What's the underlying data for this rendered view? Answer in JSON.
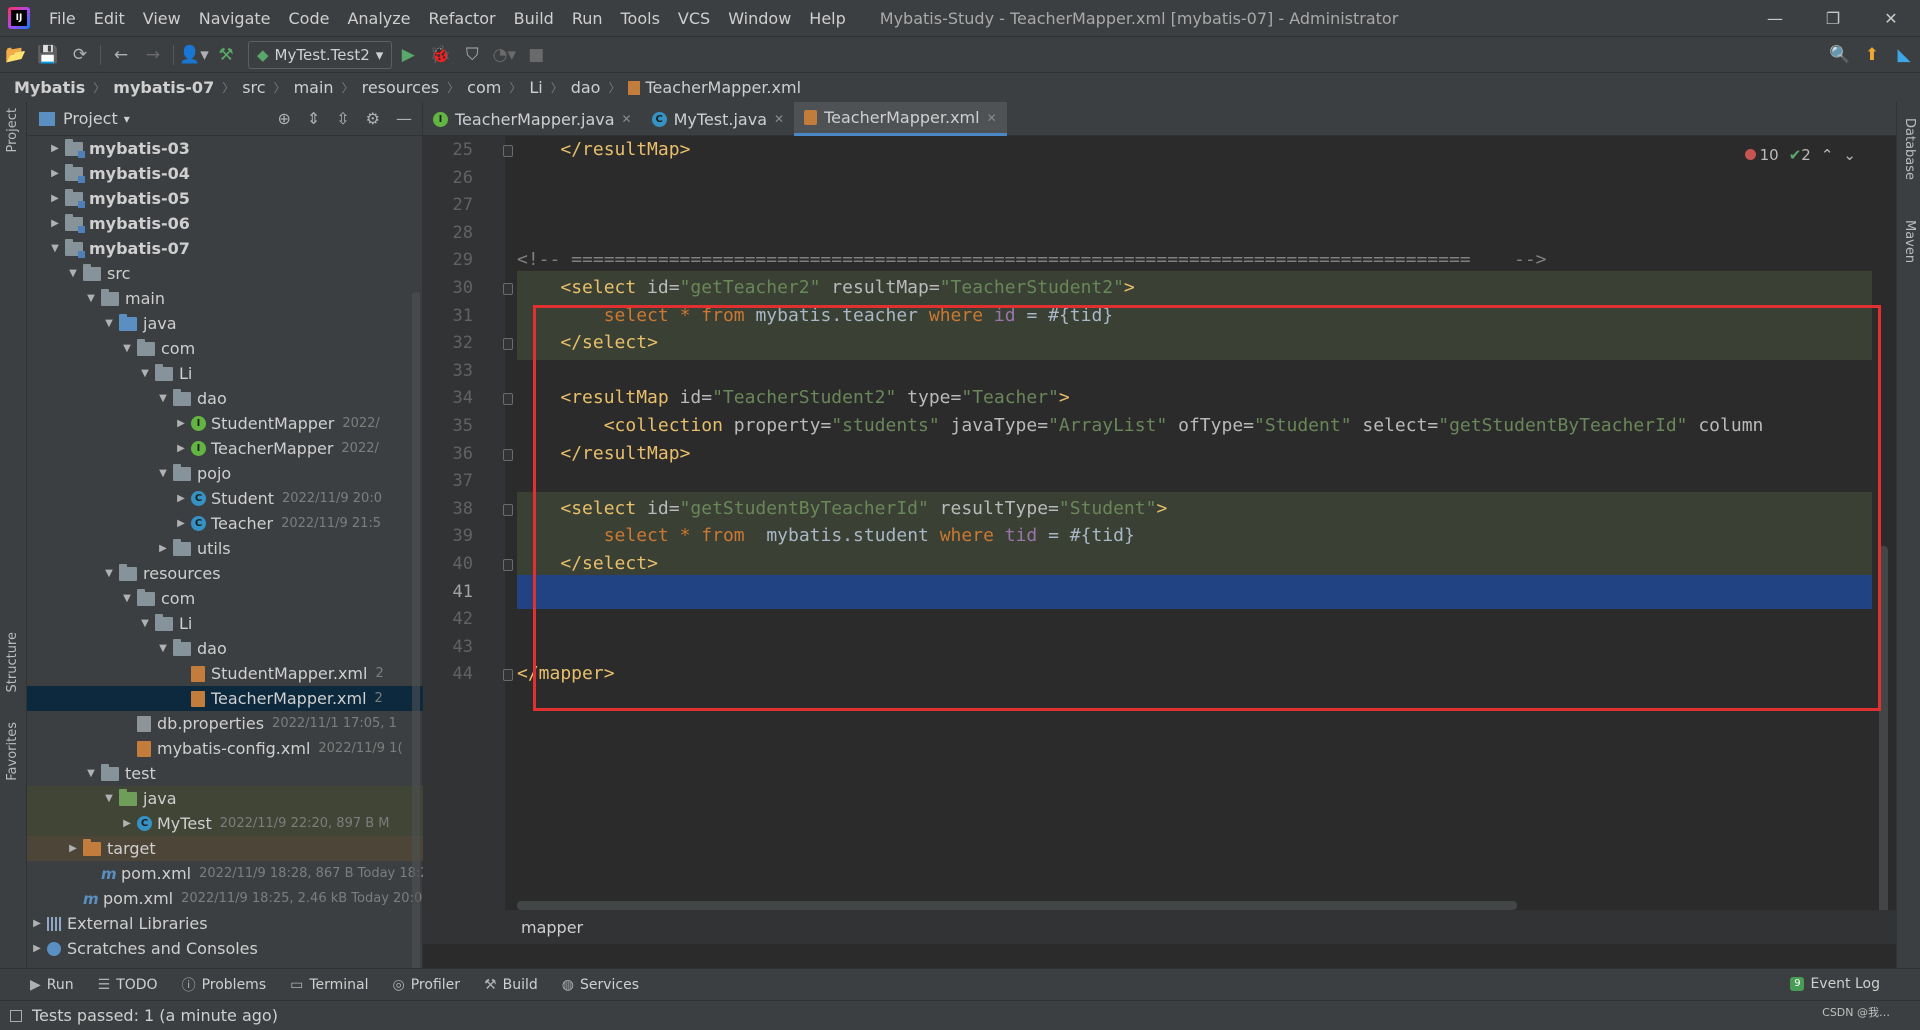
{
  "window": {
    "menu": [
      "File",
      "Edit",
      "View",
      "Navigate",
      "Code",
      "Analyze",
      "Refactor",
      "Build",
      "Run",
      "Tools",
      "VCS",
      "Window",
      "Help"
    ],
    "title": "Mybatis-Study - TeacherMapper.xml [mybatis-07] - Administrator",
    "controls": {
      "minimize": "—",
      "restore": "❐",
      "close": "✕"
    }
  },
  "toolbar": {
    "run_config": "MyTest.Test2"
  },
  "breadcrumb": [
    "Mybatis",
    "mybatis-07",
    "src",
    "main",
    "resources",
    "com",
    "Li",
    "dao",
    "TeacherMapper.xml"
  ],
  "left_stripe": {
    "project": "Project",
    "structure": "Structure",
    "favorites": "Favorites"
  },
  "right_stripe": {
    "database": "Database",
    "maven": "Maven"
  },
  "project_panel": {
    "title": "Project",
    "tree": [
      {
        "label": "mybatis-03",
        "meta": "",
        "icon": "module",
        "arrow": "›",
        "indent": 0,
        "bold": true
      },
      {
        "label": "mybatis-04",
        "meta": "",
        "icon": "module",
        "arrow": "›",
        "indent": 0,
        "bold": true
      },
      {
        "label": "mybatis-05",
        "meta": "",
        "icon": "module",
        "arrow": "›",
        "indent": 0,
        "bold": true
      },
      {
        "label": "mybatis-06",
        "meta": "",
        "icon": "module",
        "arrow": "›",
        "indent": 0,
        "bold": true
      },
      {
        "label": "mybatis-07",
        "meta": "",
        "icon": "module",
        "arrow": "⌄",
        "indent": 0,
        "bold": true
      },
      {
        "label": "src",
        "meta": "",
        "icon": "folder",
        "arrow": "⌄",
        "indent": 1
      },
      {
        "label": "main",
        "meta": "",
        "icon": "folder",
        "arrow": "⌄",
        "indent": 2
      },
      {
        "label": "java",
        "meta": "",
        "icon": "folder-blue",
        "arrow": "⌄",
        "indent": 3
      },
      {
        "label": "com",
        "meta": "",
        "icon": "folder",
        "arrow": "⌄",
        "indent": 4
      },
      {
        "label": "Li",
        "meta": "",
        "icon": "folder",
        "arrow": "⌄",
        "indent": 5
      },
      {
        "label": "dao",
        "meta": "",
        "icon": "folder",
        "arrow": "⌄",
        "indent": 6
      },
      {
        "label": "StudentMapper",
        "meta": "2022/",
        "icon": "interface",
        "arrow": "›",
        "indent": 7
      },
      {
        "label": "TeacherMapper",
        "meta": "2022/",
        "icon": "interface",
        "arrow": "›",
        "indent": 7
      },
      {
        "label": "pojo",
        "meta": "",
        "icon": "folder",
        "arrow": "⌄",
        "indent": 6
      },
      {
        "label": "Student",
        "meta": "2022/11/9 20:0",
        "icon": "class",
        "arrow": "›",
        "indent": 7
      },
      {
        "label": "Teacher",
        "meta": "2022/11/9 21:5",
        "icon": "class",
        "arrow": "›",
        "indent": 7
      },
      {
        "label": "utils",
        "meta": "",
        "icon": "folder",
        "arrow": "›",
        "indent": 6
      },
      {
        "label": "resources",
        "meta": "",
        "icon": "folder-res",
        "arrow": "⌄",
        "indent": 3
      },
      {
        "label": "com",
        "meta": "",
        "icon": "folder",
        "arrow": "⌄",
        "indent": 4
      },
      {
        "label": "Li",
        "meta": "",
        "icon": "folder",
        "arrow": "⌄",
        "indent": 5
      },
      {
        "label": "dao",
        "meta": "",
        "icon": "folder",
        "arrow": "⌄",
        "indent": 6
      },
      {
        "label": "StudentMapper.xml",
        "meta": "2",
        "icon": "xml",
        "arrow": "",
        "indent": 7
      },
      {
        "label": "TeacherMapper.xml",
        "meta": "2",
        "icon": "xml",
        "arrow": "",
        "indent": 7,
        "selected": true
      },
      {
        "label": "db.properties",
        "meta": "2022/11/1 17:05, 1",
        "icon": "props",
        "arrow": "",
        "indent": 4
      },
      {
        "label": "mybatis-config.xml",
        "meta": "2022/11/9 1(",
        "icon": "xml",
        "arrow": "",
        "indent": 4
      },
      {
        "label": "test",
        "meta": "",
        "icon": "folder",
        "arrow": "⌄",
        "indent": 2
      },
      {
        "label": "java",
        "meta": "",
        "icon": "folder-green",
        "arrow": "⌄",
        "indent": 3,
        "testbg": true
      },
      {
        "label": "MyTest",
        "meta": "2022/11/9 22:20, 897 B M",
        "icon": "class",
        "arrow": "›",
        "indent": 4,
        "testbg": true
      },
      {
        "label": "target",
        "meta": "",
        "icon": "folder-orange",
        "arrow": "›",
        "indent": 1,
        "targetbg": true
      },
      {
        "label": "pom.xml",
        "meta": "2022/11/9 18:28, 867 B Today 18:2!",
        "icon": "maven",
        "arrow": "",
        "indent": 2
      },
      {
        "label": "pom.xml",
        "meta": "2022/11/9 18:25, 2.46 kB Today 20:06",
        "icon": "maven",
        "arrow": "",
        "indent": 1
      },
      {
        "label": "External Libraries",
        "meta": "",
        "icon": "lib",
        "arrow": "›",
        "indent": -1
      },
      {
        "label": "Scratches and Consoles",
        "meta": "",
        "icon": "scratch",
        "arrow": "›",
        "indent": -1
      }
    ]
  },
  "editor_tabs": [
    {
      "label": "TeacherMapper.java",
      "icon": "I",
      "color": "#62b543",
      "active": false
    },
    {
      "label": "MyTest.java",
      "icon": "C",
      "color": "#3592c4",
      "active": false
    },
    {
      "label": "TeacherMapper.xml",
      "icon": "",
      "color": "#c27d3c",
      "active": true
    }
  ],
  "inspection": {
    "errors": "10",
    "warnings": "2"
  },
  "editor": {
    "line_numbers": [
      "25",
      "26",
      "27",
      "28",
      "29",
      "30",
      "31",
      "32",
      "33",
      "34",
      "35",
      "36",
      "37",
      "38",
      "39",
      "40",
      "41",
      "42",
      "43",
      "44"
    ],
    "current_line": "41",
    "lines": [
      "    </resultMap>",
      "",
      "",
      "",
      "<!-- ===================================================================================    -->",
      "    <select id=\"getTeacher2\" resultMap=\"TeacherStudent2\">",
      "        select * from mybatis.teacher where id = #{tid}",
      "    </select>",
      "",
      "    <resultMap id=\"TeacherStudent2\" type=\"Teacher\">",
      "        <collection property=\"students\" javaType=\"ArrayList\" ofType=\"Student\" select=\"getStudentByTeacherId\" column",
      "    </resultMap>",
      "",
      "    <select id=\"getStudentByTeacherId\" resultType=\"Student\">",
      "        select * from  mybatis.student where tid = #{tid}",
      "    </select>",
      "",
      "",
      "",
      "</mapper>"
    ],
    "breadcrumb": "mapper"
  },
  "bottom_tools": [
    "Run",
    "TODO",
    "Problems",
    "Terminal",
    "Profiler",
    "Build",
    "Services"
  ],
  "event_log": "Event Log",
  "event_log_badge": "9",
  "status": "Tests passed: 1 (a minute ago)",
  "watermark": "CSDN @我…"
}
